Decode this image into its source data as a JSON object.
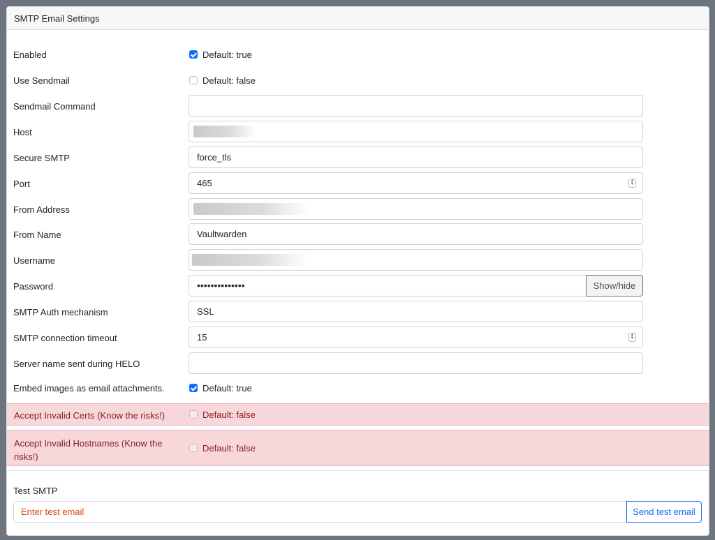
{
  "card": {
    "title": "SMTP Email Settings"
  },
  "fields": {
    "enabled": {
      "label": "Enabled",
      "checked": true,
      "default_text": "Default: true"
    },
    "use_sendmail": {
      "label": "Use Sendmail",
      "checked": false,
      "default_text": "Default: false"
    },
    "sendmail_command": {
      "label": "Sendmail Command",
      "value": ""
    },
    "host": {
      "label": "Host",
      "value": ""
    },
    "secure_smtp": {
      "label": "Secure SMTP",
      "value": "force_tls"
    },
    "port": {
      "label": "Port",
      "value": "465"
    },
    "from_address": {
      "label": "From Address",
      "value": ""
    },
    "from_name": {
      "label": "From Name",
      "value": "Vaultwarden"
    },
    "username": {
      "label": "Username",
      "value": ""
    },
    "password": {
      "label": "Password",
      "value": "••••••••••••••",
      "toggle_label": "Show/hide"
    },
    "auth_mechanism": {
      "label": "SMTP Auth mechanism",
      "value": "SSL"
    },
    "timeout": {
      "label": "SMTP connection timeout",
      "value": "15"
    },
    "helo_name": {
      "label": "Server name sent during HELO",
      "value": ""
    },
    "embed_images": {
      "label": "Embed images as email attachments.",
      "checked": true,
      "default_text": "Default: true"
    },
    "accept_invalid_certs": {
      "label": "Accept Invalid Certs (Know the risks!)",
      "checked": false,
      "default_text": "Default: false"
    },
    "accept_invalid_hostnames": {
      "label_line1": "Accept Invalid Hostnames (Know the",
      "label_line2": "risks!)",
      "checked": false,
      "default_text": "Default: false"
    }
  },
  "test_smtp": {
    "label": "Test SMTP",
    "placeholder": "Enter test email",
    "button_label": "Send test email"
  },
  "colors": {
    "accent": "#0d6efd",
    "danger_bg": "#f8d7da",
    "danger_text": "#842029",
    "backdrop": "#6c757d"
  }
}
